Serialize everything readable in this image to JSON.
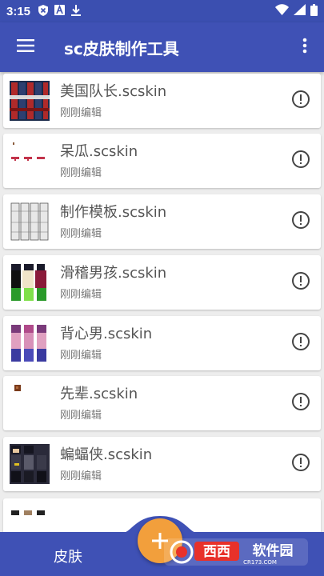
{
  "status_bar": {
    "time": "3:15"
  },
  "app_bar": {
    "title": "sc皮肤制作工具"
  },
  "items": [
    {
      "name": "美国队长.scskin",
      "subtitle": "刚刚编辑"
    },
    {
      "name": "呆瓜.scskin",
      "subtitle": "刚刚编辑"
    },
    {
      "name": "制作模板.scskin",
      "subtitle": "刚刚编辑"
    },
    {
      "name": "滑稽男孩.scskin",
      "subtitle": "刚刚编辑"
    },
    {
      "name": "背心男.scskin",
      "subtitle": "刚刚编辑"
    },
    {
      "name": "先辈.scskin",
      "subtitle": "刚刚编辑"
    },
    {
      "name": "蝙蝠侠.scskin",
      "subtitle": "刚刚编辑"
    }
  ],
  "bottom_nav": {
    "tab_label": "皮肤"
  },
  "watermark": {
    "brand": "西西软件园",
    "domain": "CR173.COM"
  },
  "colors": {
    "primary": "#3f51b5",
    "fab": "#f29f3c",
    "background": "#ededed"
  }
}
